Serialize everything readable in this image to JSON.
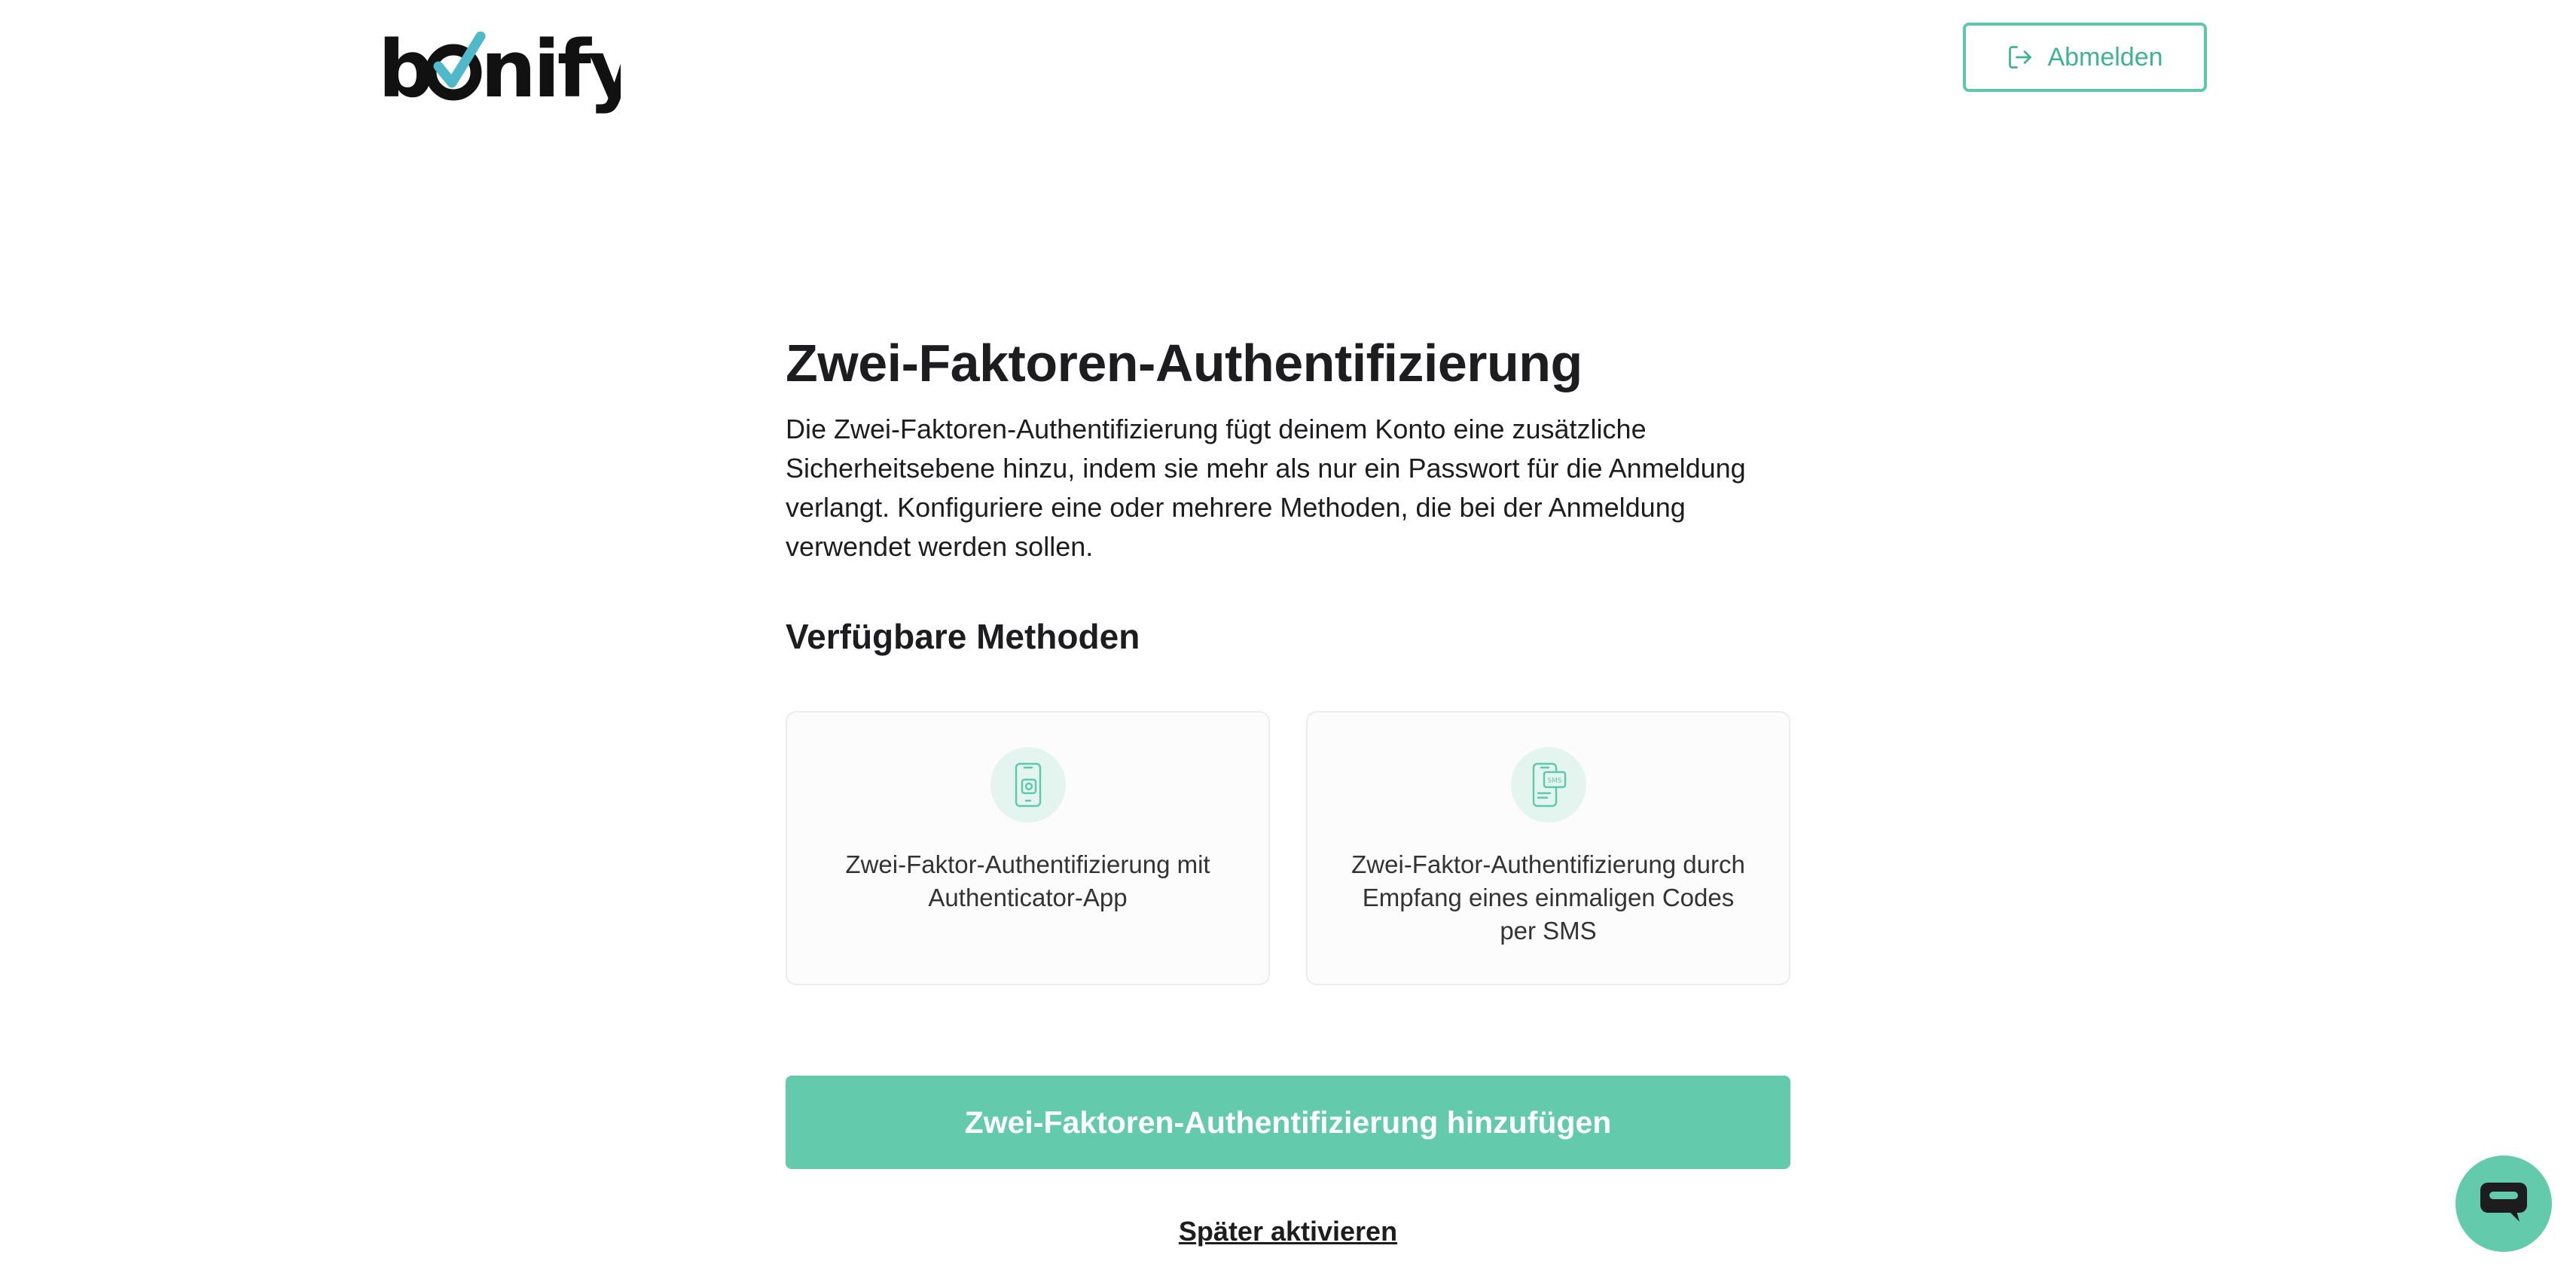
{
  "header": {
    "logo_text": "bonify",
    "logout_label": "Abmelden"
  },
  "main": {
    "title": "Zwei-Faktoren-Authentifizierung",
    "description": "Die Zwei-Faktoren-Authentifizierung fügt deinem Konto eine zusätzliche Sicherheitsebene hinzu, indem sie mehr als nur ein Passwort für die Anmeldung verlangt. Konfiguriere eine oder mehrere Methoden, die bei der Anmeldung verwendet werden sollen.",
    "methods_heading": "Verfügbare Methoden",
    "methods": [
      {
        "label": "Zwei-Faktor-Authentifizierung mit Authenticator-App",
        "icon": "authenticator-app-icon"
      },
      {
        "label": "Zwei-Faktor-Authentifizierung durch Empfang eines einmaligen Codes per SMS",
        "icon": "sms-phone-icon"
      }
    ],
    "add_button_label": "Zwei-Faktoren-Authentifizierung hinzufügen",
    "later_link_label": "Später aktivieren"
  },
  "chat": {
    "icon": "chat-bubble-icon"
  },
  "colors": {
    "accent": "#63cbac",
    "accent_dark": "#3fb391",
    "icon_bg": "#e3f5ee",
    "text": "#1d1d1f"
  }
}
